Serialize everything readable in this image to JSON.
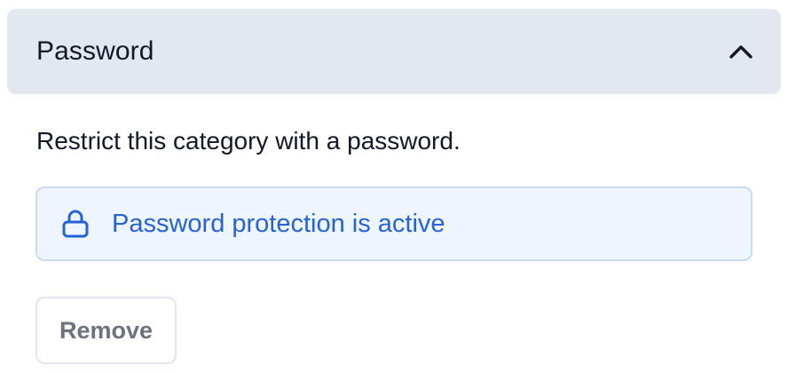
{
  "section": {
    "title": "Password",
    "expanded": true,
    "toggle_icon": "chevron-up-icon"
  },
  "description": "Restrict this category with a password.",
  "status": {
    "icon": "lock-icon",
    "text": "Password protection is active"
  },
  "actions": {
    "remove_label": "Remove"
  },
  "colors": {
    "header_background": "#e3e8f0",
    "status_background": "#eef5ff",
    "status_border": "#c6dbf6",
    "accent": "#2563d6",
    "button_text": "#6b7280"
  }
}
